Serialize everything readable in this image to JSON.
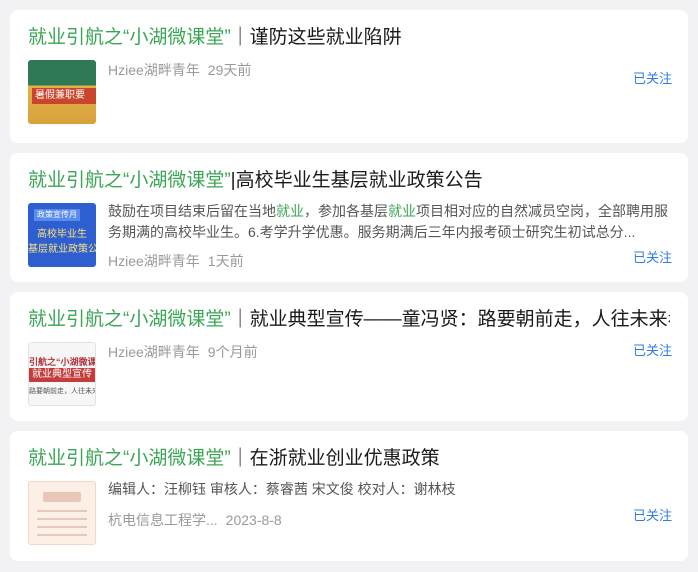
{
  "cards": [
    {
      "title_highlight": "就业引航之“小湖微课堂”",
      "title_rest": "｜谨防这些就业陷阱",
      "source": "Hziee湖畔青年",
      "date": "29天前",
      "follow_label": "已关注",
      "thumb_text": "暑假兼职要"
    },
    {
      "title_highlight": "就业引航之“小湖微课堂”",
      "title_rest": "|高校毕业生基层就业政策公告",
      "summary_parts": [
        "鼓励在项目结束后留在当地",
        "就业",
        "，参加各基层",
        "就业",
        "项目相对应的自然减员空岗，全部聘用服务期满的高校毕业生。6.考学升学优惠。服务期满后三年内报考硕士研究生初试总分..."
      ],
      "source": "Hziee湖畔青年",
      "date": "1天前",
      "follow_label": "已关注",
      "thumb_label": "政策宣传月",
      "thumb_line1": "高校毕业生",
      "thumb_line2": "基层就业政策公告"
    },
    {
      "title_highlight": "就业引航之“小湖微课堂”",
      "title_rest": "｜就业典型宣传——童冯贤：路要朝前走，人往未来看",
      "source": "Hziee湖畔青年",
      "date": "9个月前",
      "follow_label": "已关注",
      "thumb_line1": "引航之“小湖微课堂",
      "thumb_line2": "就业典型宣传",
      "thumb_line3": "路要朝前走，人往未来看"
    },
    {
      "title_highlight": "就业引航之“小湖微课堂”",
      "title_rest": "｜在浙就业创业优惠政策",
      "summary_parts": [
        "编辑人：汪柳钰 审核人：蔡睿茜 宋文俊 校对人：谢林枝"
      ],
      "source": "杭电信息工程学...",
      "date": "2023-8-8",
      "follow_label": "已关注"
    }
  ],
  "colors": {
    "highlight": "#3aa655",
    "follow": "#2f7de1",
    "meta": "#9a9a9a"
  }
}
